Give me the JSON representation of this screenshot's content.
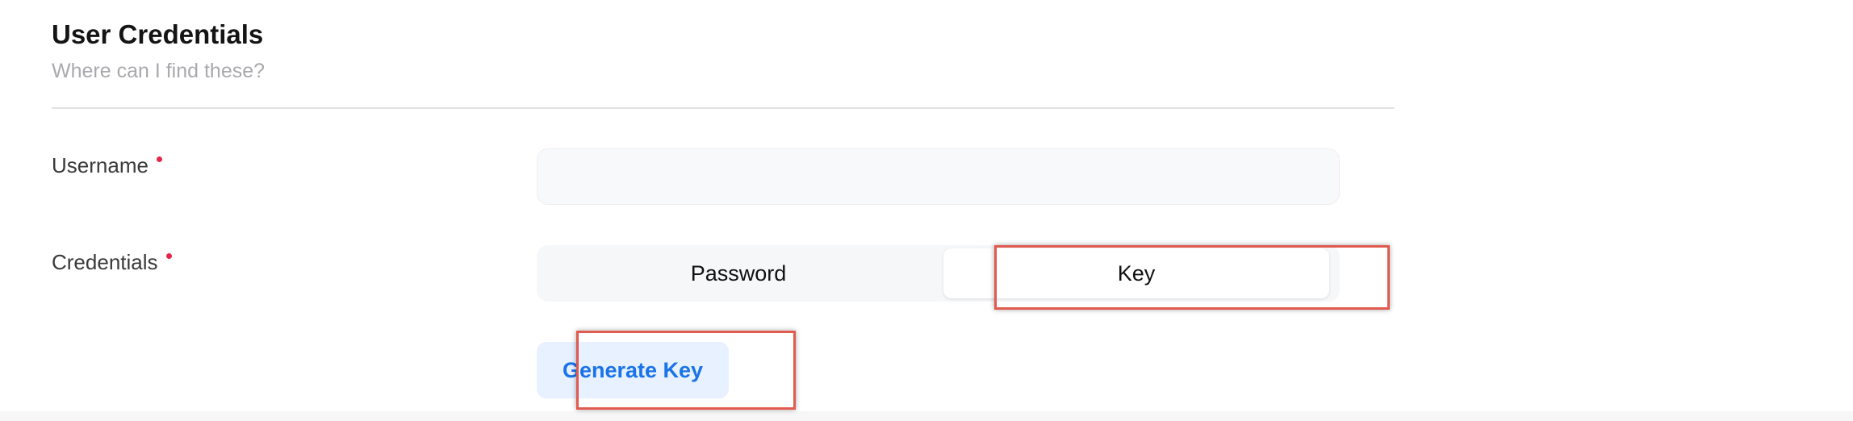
{
  "section": {
    "title": "User Credentials",
    "help_link": "Where can I find these?"
  },
  "fields": {
    "username": {
      "label": "Username",
      "required": true,
      "value": "",
      "placeholder": ""
    },
    "credentials": {
      "label": "Credentials",
      "required": true,
      "options": [
        "Password",
        "Key"
      ],
      "selected": "Key"
    }
  },
  "actions": {
    "generate_key_label": "Generate Key"
  },
  "colors": {
    "required_dot": "#e5264a",
    "accent": "#1a73e8",
    "accent_bg": "#e7f1ff",
    "highlight": "#e05a4f"
  }
}
